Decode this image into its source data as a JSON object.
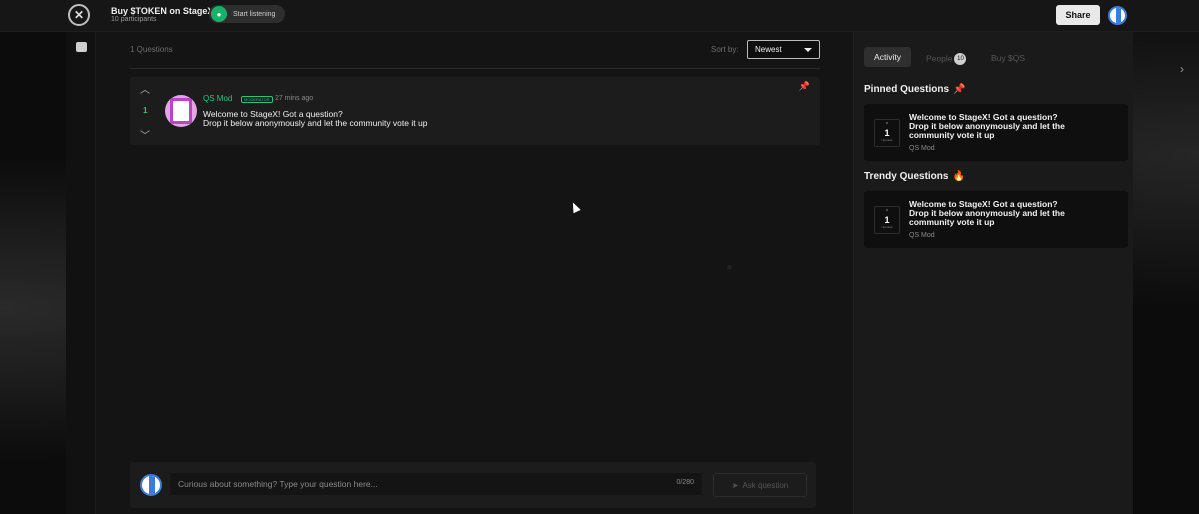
{
  "topbar": {
    "title": "Buy $TOKEN on StageX",
    "participants": "10 participants",
    "listen_label": "Start listening",
    "share_label": "Share"
  },
  "main": {
    "question_count": "1 Questions",
    "sort_label": "Sort by:",
    "sort_value": "Newest",
    "question": {
      "votes": "1",
      "author": "QS Mod",
      "badge": "MODERATOR",
      "time": "27 mins ago",
      "line1": "Welcome to StageX! Got a question?",
      "line2": "Drop it below anonymously and let the community vote it up"
    }
  },
  "composer": {
    "placeholder": "Curious about something? Type your question here...",
    "char_count": "0/280",
    "ask_label": "Ask question"
  },
  "panel": {
    "tabs": {
      "activity": "Activity",
      "people": "People",
      "people_count": "10",
      "buy": "Buy $QS"
    },
    "pinned": {
      "title": "Pinned Questions",
      "icon": "📌",
      "card": {
        "votes": "1",
        "votes_label": "Upvotes",
        "text_line1": "Welcome to StageX! Got a question?",
        "text_line2": "Drop it below anonymously and let the",
        "text_line3": "community vote it up",
        "author": "QS Mod"
      }
    },
    "trendy": {
      "title": "Trendy Questions",
      "icon": "🔥",
      "card": {
        "votes": "1",
        "votes_label": "Upvotes",
        "text_line1": "Welcome to StageX! Got a question?",
        "text_line2": "Drop it below anonymously and let the",
        "text_line3": "community vote it up",
        "author": "QS Mod"
      }
    }
  },
  "colors": {
    "accent": "#2ec27e",
    "mic": "#17b26a",
    "pin": "#e03131"
  }
}
